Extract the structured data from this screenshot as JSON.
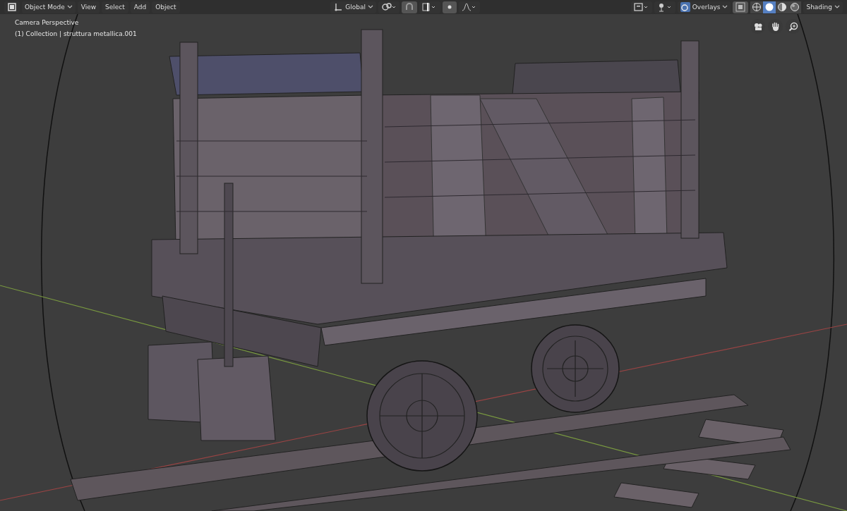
{
  "header": {
    "mode_menu": "Object Mode",
    "menus": [
      "View",
      "Select",
      "Add",
      "Object"
    ],
    "transform_orientation": "Global",
    "overlays": "Overlays",
    "shading": "Shading",
    "shading_modes": [
      {
        "kind": "wireframe",
        "selected": false
      },
      {
        "kind": "solid",
        "selected": true
      },
      {
        "kind": "material",
        "selected": false
      },
      {
        "kind": "rendered",
        "selected": false
      }
    ]
  },
  "viewport": {
    "camera_label": "Camera Perspective",
    "object_label": "(1) Collection | struttura metallica.001"
  }
}
